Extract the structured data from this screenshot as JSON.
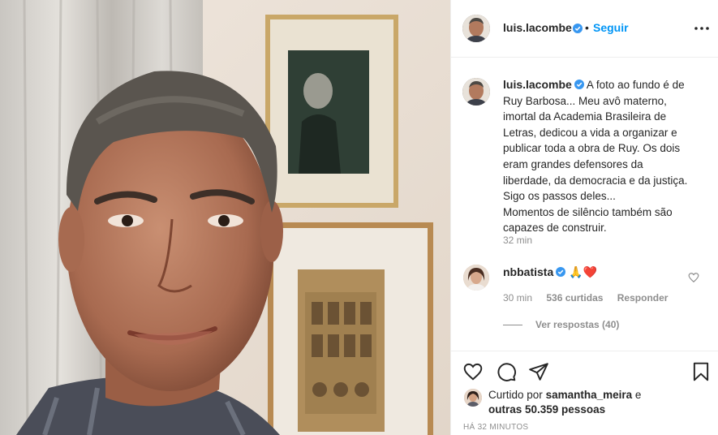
{
  "post": {
    "author": "luis.lacombe",
    "verified": true,
    "follow_label": "Seguir",
    "separator": "•",
    "caption_lines": [
      "A foto ao fundo é de",
      "Ruy Barbosa... Meu avô materno,",
      "imortal da Academia Brasileira de",
      "Letras, dedicou a vida a organizar e",
      "publicar toda a obra de Ruy. Os dois",
      "eram grandes defensores da",
      "liberdade, da democracia e da justiça.",
      "Sigo os passos deles...",
      "Momentos de silêncio também são",
      "capazes de construir."
    ],
    "caption_time": "32 min"
  },
  "comment": {
    "author": "nbbatista",
    "verified": true,
    "emoji": "🙏❤️",
    "time": "30 min",
    "likes": "536 curtidas",
    "reply_label": "Responder",
    "view_replies": "Ver respostas (40)"
  },
  "likes": {
    "prefix": "Curtido por",
    "user": "samantha_meira",
    "and": "e",
    "others": "outras 50.359 pessoas"
  },
  "timestamp": "HÁ 32 MINUTOS",
  "icons": {
    "like": "heart-icon",
    "comment": "comment-icon",
    "share": "share-icon",
    "save": "bookmark-icon",
    "more": "more-options-icon",
    "verified": "verified-badge-icon"
  },
  "colors": {
    "accent": "#0095f6",
    "verified": "#3897f0",
    "muted": "#8e8e8e",
    "heart": "#ed4956"
  }
}
